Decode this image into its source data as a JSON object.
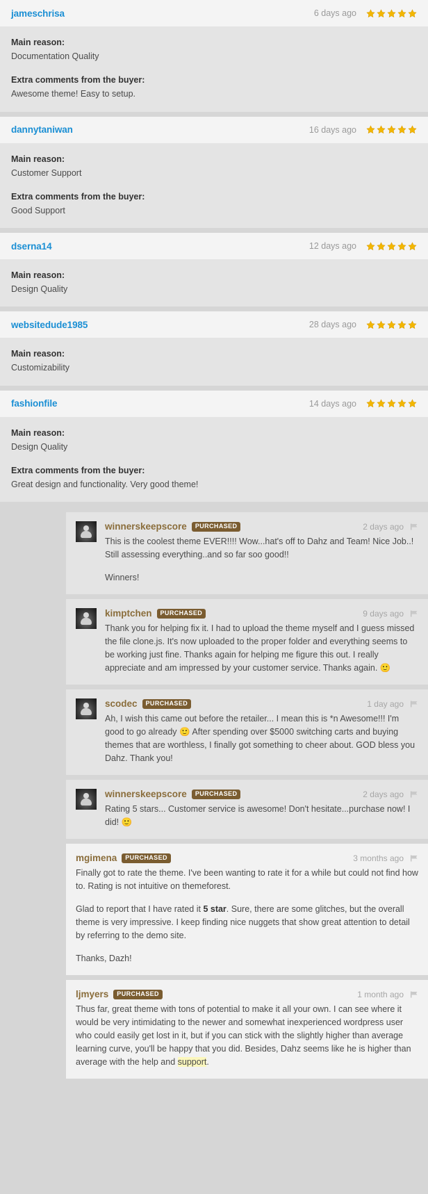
{
  "labels": {
    "main_reason": "Main reason:",
    "extra_comments": "Extra comments from the buyer:",
    "purchased_badge": "PURCHASED"
  },
  "colors": {
    "rating_username": "#1b8fd4",
    "comment_username": "#8a6d3b",
    "badge_bg": "#7a5c30",
    "star": "#f3b700",
    "highlight": "#fbf7bd",
    "page_bg": "#d6d6d6",
    "rating_head_bg": "#f4f4f4",
    "rating_body_bg": "#e4e4e4",
    "comment_light_bg": "#f2f2f2"
  },
  "ratings": [
    {
      "username": "jameschrisa",
      "ago": "6 days ago",
      "stars": 5,
      "main_reason": "Documentation Quality",
      "extra_comments": "Awesome theme! Easy to setup."
    },
    {
      "username": "dannytaniwan",
      "ago": "16 days ago",
      "stars": 5,
      "main_reason": "Customer Support",
      "extra_comments": "Good Support"
    },
    {
      "username": "dserna14",
      "ago": "12 days ago",
      "stars": 5,
      "main_reason": "Design Quality",
      "extra_comments": null
    },
    {
      "username": "websitedude1985",
      "ago": "28 days ago",
      "stars": 5,
      "main_reason": "Customizability",
      "extra_comments": null
    },
    {
      "username": "fashionfile",
      "ago": "14 days ago",
      "stars": 5,
      "main_reason": "Design Quality",
      "extra_comments": "Great design and functionality. Very good theme!"
    }
  ],
  "comments": [
    {
      "username": "winnerskeepscore",
      "badge": "PURCHASED",
      "ago": "2 days ago",
      "has_avatar": true,
      "style": "dark",
      "paragraphs": [
        "This is the coolest theme EVER!!!! Wow...hat's off to Dahz and Team! Nice Job..! Still assessing everything..and so far soo good!!",
        "Winners!"
      ]
    },
    {
      "username": "kimptchen",
      "badge": "PURCHASED",
      "ago": "9 days ago",
      "has_avatar": true,
      "style": "dark",
      "paragraphs": [
        "Thank you for helping fix it. I had to upload the theme myself and I guess missed the file clone.js. It's now uploaded to the proper folder and everything seems to be working just fine. Thanks again for helping me figure this out. I really appreciate and am impressed by your customer service. Thanks again. ὤ2"
      ],
      "emoji_end": true
    },
    {
      "username": "scodec",
      "badge": "PURCHASED",
      "ago": "1 day ago",
      "has_avatar": true,
      "style": "dark",
      "paragraphs": [
        "Ah, I wish this came out before the retailer... I mean this is *n Awesome!!! I'm good to go already ὤ2 After spending over $5000 switching carts and buying themes that are worthless, I finally got something to cheer about. GOD bless you Dahz. Thank you!"
      ]
    },
    {
      "username": "winnerskeepscore",
      "badge": "PURCHASED",
      "ago": "2 days ago",
      "has_avatar": true,
      "style": "dark",
      "paragraphs": [
        "Rating 5 stars... Customer service is awesome! Don't hesitate...purchase now! I did! ὤ2"
      ]
    },
    {
      "username": "mgimena",
      "badge": "PURCHASED",
      "ago": "3 months ago",
      "has_avatar": false,
      "style": "light",
      "paragraphs": [
        "Finally got to rate the theme. I've been wanting to rate it for a while but could not find how to. Rating is not intuitive on themeforest.",
        "Glad to report that I have rated it 5 star. Sure, there are some glitches, but the overall theme is very impressive. I keep finding nice nuggets that show great attention to detail by referring to the demo site.",
        "Thanks, Dazh!"
      ]
    },
    {
      "username": "ljmyers",
      "badge": "PURCHASED",
      "ago": "1 month ago",
      "has_avatar": false,
      "style": "light",
      "paragraphs": [
        "Thus far, great theme with tons of potential to make it all your own. I can see where it would be very intimidating to the newer and somewhat inexperienced wordpress user who could easily get lost in it, but if you can stick with the slightly higher than average learning curve, you'll be happy that you did. Besides, Dahz seems like he is higher than average with the help and support."
      ]
    }
  ]
}
